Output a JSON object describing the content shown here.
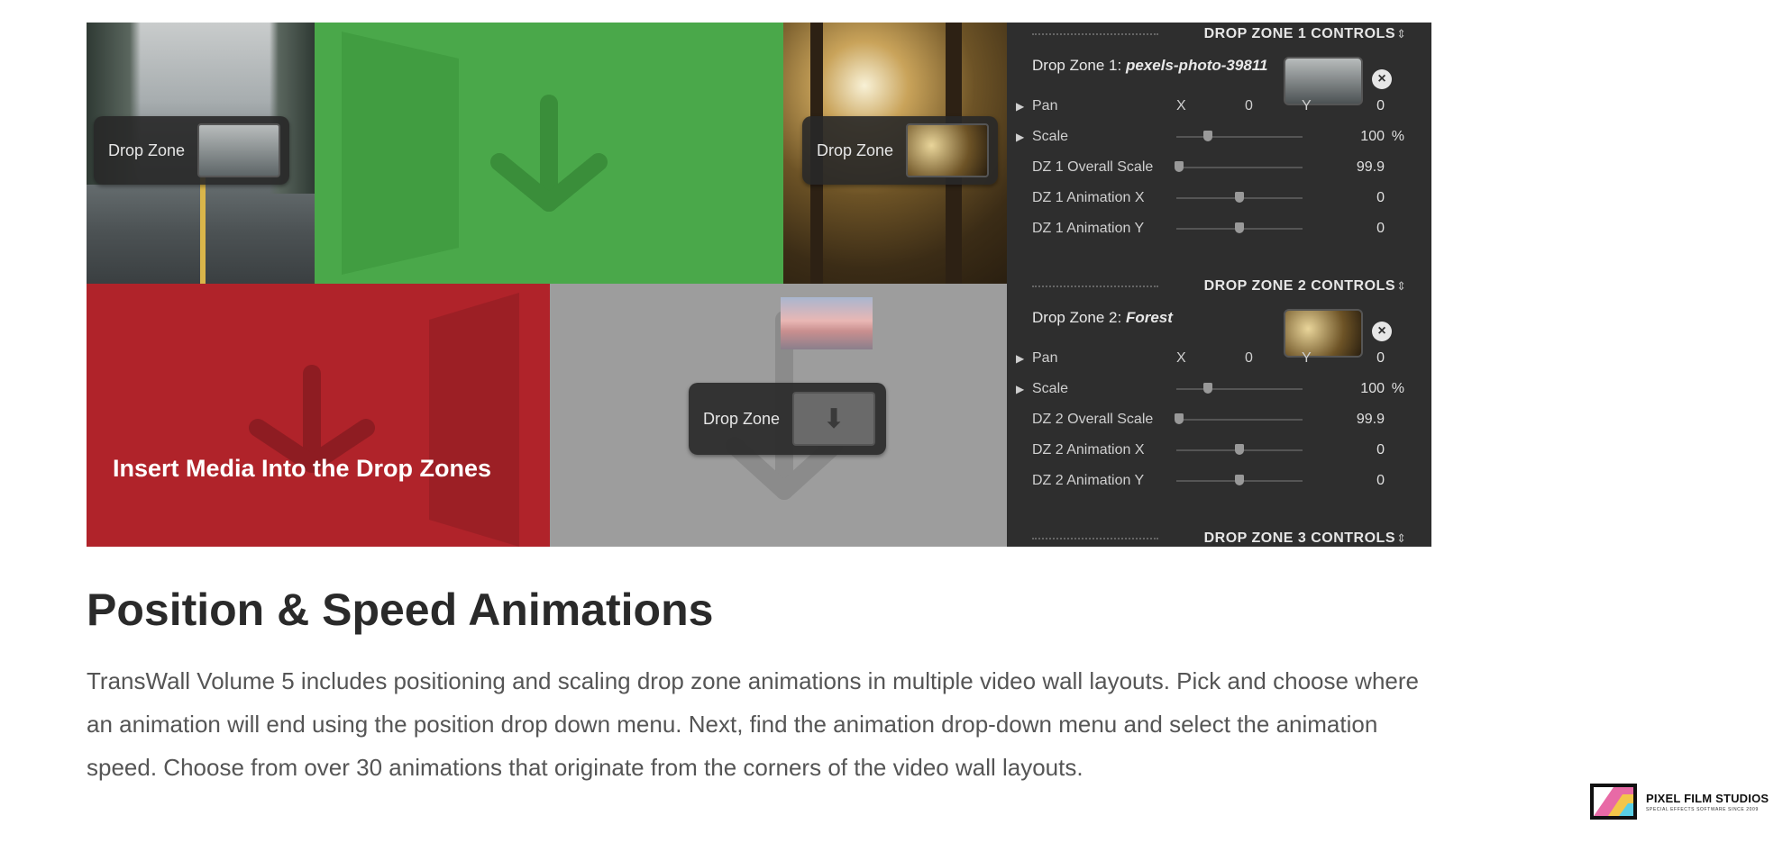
{
  "hero": {
    "drop_zone_label": "Drop Zone",
    "banner_text": "Insert Media Into the Drop Zones"
  },
  "panel": {
    "sections": [
      {
        "header": "DROP ZONE 1 CONTROLS",
        "name_prefix": "Drop Zone 1:",
        "name_value": "pexels-photo-39811",
        "rows": [
          {
            "label": "Pan",
            "x_label": "X",
            "x_value": "0",
            "y_label": "Y",
            "y_value": "0"
          },
          {
            "label": "Scale",
            "value": "100",
            "unit": "%",
            "level": 0.25
          },
          {
            "label": "DZ 1 Overall Scale",
            "value": "99.9",
            "level": 0.02
          },
          {
            "label": "DZ 1 Animation X",
            "value": "0",
            "level": 0.5
          },
          {
            "label": "DZ 1 Animation Y",
            "value": "0",
            "level": 0.5
          }
        ]
      },
      {
        "header": "DROP ZONE 2 CONTROLS",
        "name_prefix": "Drop Zone 2:",
        "name_value": "Forest",
        "rows": [
          {
            "label": "Pan",
            "x_label": "X",
            "x_value": "0",
            "y_label": "Y",
            "y_value": "0"
          },
          {
            "label": "Scale",
            "value": "100",
            "unit": "%",
            "level": 0.25
          },
          {
            "label": "DZ 2 Overall Scale",
            "value": "99.9",
            "level": 0.02
          },
          {
            "label": "DZ 2 Animation X",
            "value": "0",
            "level": 0.5
          },
          {
            "label": "DZ 2 Animation Y",
            "value": "0",
            "level": 0.5
          }
        ]
      },
      {
        "header": "DROP ZONE 3 CONTROLS"
      }
    ]
  },
  "content": {
    "title": "Position & Speed Animations",
    "description": "TransWall Volume 5 includes positioning and scaling drop zone animations in multiple video wall layouts.  Pick and choose where an animation will end using the position drop down menu.  Next, find the animation drop-down menu and select the animation speed.  Choose from over 30 animations that originate from the corners of the video wall layouts."
  },
  "brand": {
    "name": "PIXEL FILM STUDIOS",
    "tagline": "SPECIAL EFFECTS SOFTWARE SINCE 2009"
  },
  "colors": {
    "green_tile": "#4aa84a",
    "red_tile": "#b0232a",
    "grey_tile": "#9d9d9d",
    "panel_bg": "#2e2e2e"
  }
}
